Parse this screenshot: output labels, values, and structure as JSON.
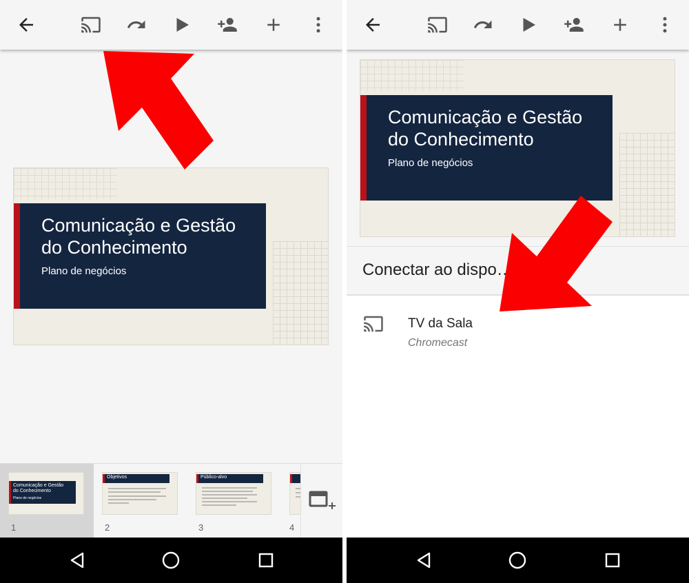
{
  "slide": {
    "title_line1": "Comunicação e Gestão",
    "title_line2": "do Conhecimento",
    "subtitle": "Plano de negócios"
  },
  "toolbar": {
    "icons": [
      "back-arrow-icon",
      "cast-icon",
      "redo-icon",
      "play-icon",
      "add-person-icon",
      "add-icon",
      "more-vert-icon"
    ]
  },
  "thumbnails": [
    {
      "number": "1",
      "title_line1": "Comunicação e Gestão",
      "title_line2": "do Conhecimento",
      "subtitle": "Plano de negócios"
    },
    {
      "number": "2",
      "title": "Objetivos"
    },
    {
      "number": "3",
      "title": "Público-alvo"
    },
    {
      "number": "4"
    }
  ],
  "cast_dialog": {
    "title": "Conectar ao dispo…",
    "device_name": "TV da Sala",
    "device_type": "Chromecast"
  },
  "colors": {
    "arrow": "#fb0000",
    "slide_title_bg": "#142540",
    "slide_accent": "#b8121b",
    "slide_bg": "#efede4"
  }
}
